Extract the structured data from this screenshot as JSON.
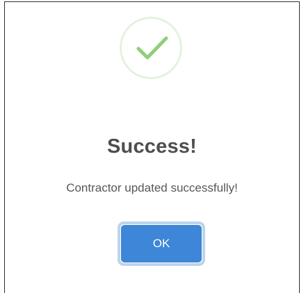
{
  "dialog": {
    "icon": "check-icon",
    "title": "Success!",
    "message": "Contractor updated successfully!",
    "ok_label": "OK"
  },
  "colors": {
    "accent": "#3d86d8",
    "success": "#8fcf77",
    "success_ring": "#e3f3dc",
    "title_text": "#4e4e4e"
  }
}
